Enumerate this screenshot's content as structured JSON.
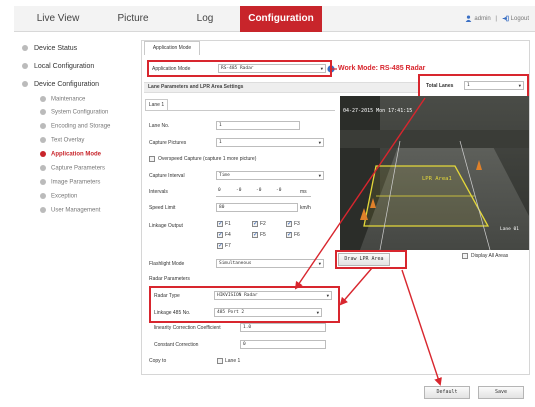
{
  "nav": {
    "tabs": [
      {
        "label": "Live View"
      },
      {
        "label": "Picture"
      },
      {
        "label": "Log"
      },
      {
        "label": "Configuration"
      }
    ],
    "user": "admin",
    "logout": "Logout"
  },
  "sidebar": {
    "groups": [
      {
        "label": "Device Status"
      },
      {
        "label": "Local Configuration"
      },
      {
        "label": "Device Configuration"
      }
    ],
    "items": [
      {
        "label": "Maintenance"
      },
      {
        "label": "System Configuration"
      },
      {
        "label": "Encoding and Storage"
      },
      {
        "label": "Text Overlay"
      },
      {
        "label": "Application Mode"
      },
      {
        "label": "Capture Parameters"
      },
      {
        "label": "Image Parameters"
      },
      {
        "label": "Exception"
      },
      {
        "label": "User Management"
      }
    ]
  },
  "panel": {
    "tab": "Application Mode",
    "app_mode_label": "Application Mode",
    "app_mode_value": "RS-485 Radar",
    "work_mode": "Work Mode: RS-485 Radar",
    "section_title": "Lane Parameters and LPR Area Settings",
    "total_lanes_label": "Total Lanes",
    "total_lanes_value": "1",
    "lane_tab": "Lane 1",
    "lane_no_label": "Lane No.",
    "lane_no_value": "1",
    "capture_pictures_label": "Capture Pictures",
    "capture_pictures_value": "1",
    "overspeed_label": "Overspeed Capture (capture 1 more picture)",
    "capture_interval_label": "Capture Interval",
    "capture_interval_value": "Time",
    "intervals_label": "Intervals",
    "intervals_values": [
      "0",
      "-0",
      "-0",
      "-0"
    ],
    "intervals_unit": "ms",
    "speed_limit_label": "Speed Limit",
    "speed_limit_value": "80",
    "speed_unit": "km/h",
    "linkage_output_label": "Linkage Output",
    "linkage_outputs": [
      "F1",
      "F2",
      "F3",
      "F4",
      "F5",
      "F6",
      "F7"
    ],
    "flashlight_label": "Flashlight Mode",
    "flashlight_value": "Simultaneous",
    "radar_params_label": "Radar Parameters",
    "radar_type_label": "Radar Type",
    "radar_type_value": "HIKVISION Radar",
    "linkage485_label": "Linkage 485 No.",
    "linkage485_value": "485 Port 2",
    "linearity_label": "linearity Correction Coefficient",
    "linearity_value": "1.0",
    "constant_label": "Constant Correction",
    "constant_value": "0",
    "copy_to_label": "Copy to",
    "copy_to_lane": "Lane 1",
    "cam_timestamp": "04-27-2015 Mon 17:41:15",
    "lpr_area_label": "LPR Area1",
    "lane_label_cam": "Lane 01",
    "draw_lpr_button": "Draw LPR Area",
    "display_all_label": "Display All Areas",
    "default_button": "Default",
    "save_button": "Save"
  },
  "colors": {
    "accent_red": "#c8252b",
    "annotation_red": "#d8262e",
    "lpr_yellow": "#e4d83a"
  }
}
